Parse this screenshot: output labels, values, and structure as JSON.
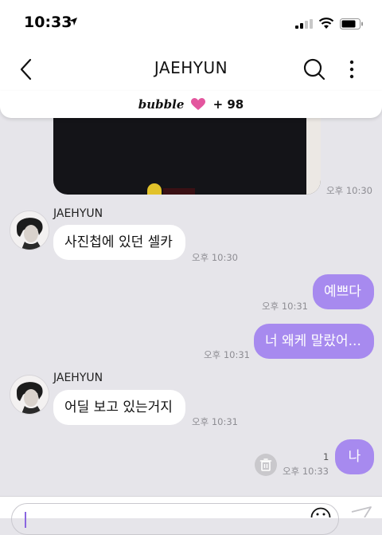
{
  "status_bar": {
    "time": "10:33"
  },
  "header": {
    "title": "JAEHYUN"
  },
  "bubble_banner": {
    "label": "bubble",
    "count": "+ 98"
  },
  "messages": {
    "photo_time": "오후 10:30",
    "group1": {
      "sender": "JAEHYUN",
      "text": "사진첩에 있던 셀카",
      "time": "오후 10:30"
    },
    "out1": {
      "text": "예쁘다",
      "time": "오후 10:31"
    },
    "out2": {
      "text": "너 왜케 말랐어...",
      "time": "오후 10:31"
    },
    "group2": {
      "sender": "JAEHYUN",
      "text": "어딜 보고 있는거지",
      "time": "오후 10:31"
    },
    "out3": {
      "text": "나",
      "time": "오후 10:33",
      "read_count": "1"
    }
  },
  "colors": {
    "accent": "#a78aef",
    "heart": "#e3569e",
    "background": "#e6e5ea"
  },
  "icons": [
    "location-arrow-icon",
    "signal-icon",
    "wifi-icon",
    "battery-icon",
    "back-icon",
    "search-icon",
    "more-icon",
    "heart-icon",
    "trash-icon",
    "emoji-icon",
    "send-icon"
  ]
}
